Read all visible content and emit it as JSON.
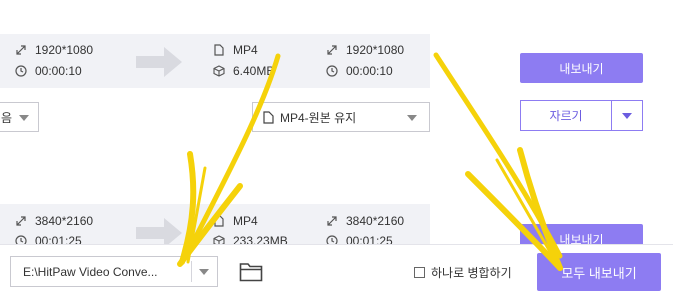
{
  "file1": {
    "src_resolution": "1920*1080",
    "src_duration": "00:00:10",
    "out_format": "MP4",
    "out_size": "6.40MB",
    "out_resolution": "1920*1080",
    "out_duration": "00:00:10",
    "export_label": "내보내기",
    "left_select_value": "음",
    "format_select_value": "MP4-원본 유지",
    "trim_label": "자르기"
  },
  "file2": {
    "src_resolution": "3840*2160",
    "src_duration": "00:01:25",
    "out_format": "MP4",
    "out_size": "233.23MB",
    "out_resolution": "3840*2160",
    "out_duration": "00:01:25",
    "export_label": "내보내기"
  },
  "bottom": {
    "output_path": "E:\\HitPaw Video Conve...",
    "merge_label": "하나로 병합하기",
    "export_all_label": "모두 내보내기"
  },
  "colors": {
    "accent": "#8d7cf2",
    "row_bg": "#f1f2f6",
    "annotation_arrow": "#f5d20a"
  }
}
